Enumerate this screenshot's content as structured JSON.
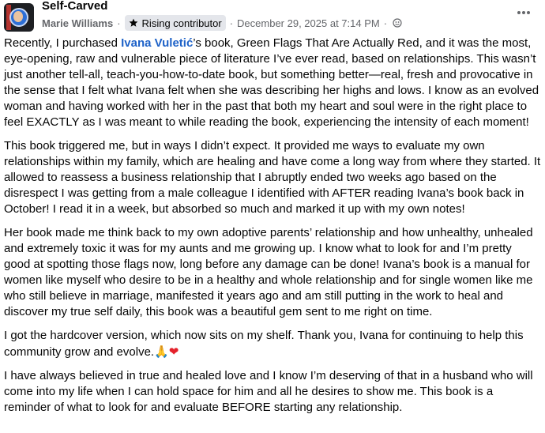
{
  "header": {
    "group_name": "Self-Carved",
    "author": "Marie Williams",
    "badge_label": "Rising contributor",
    "badge_icon": "star-icon",
    "date": "December 29, 2025 at 7:14 PM",
    "audience_icon": "globe-icon",
    "more_icon": "more-horizontal-icon",
    "separator": "·"
  },
  "post": {
    "p1_pre": "Recently, I purchased ",
    "p1_mention": "Ivana Vuletić",
    "p1_post": "’s book, Green Flags That Are Actually Red, and it was the most, eye-opening, raw and vulnerable piece of literature I’ve ever read, based on relationships. This wasn’t just another tell-all, teach-you-how-to-date book, but something better—real, fresh and provocative in the sense that I felt what Ivana felt when she was describing her highs and lows. I know as an evolved woman and having worked with her in the past that both my heart and soul were in the right place to feel EXACTLY as I was meant to while reading the book, experiencing the intensity of each moment!",
    "p2": "This book triggered me, but in ways I didn’t expect. It provided me ways to evaluate my own relationships within my family, which are healing and have come a long way from where they started. It allowed to reassess a business relationship that I abruptly ended two weeks ago based on the disrespect I was getting from a male colleague I identified with AFTER reading Ivana’s book back in October! I read it in a week, but absorbed so much and marked it up with my own notes!",
    "p3": "Her book made me think back to my own adoptive parents’ relationship and how unhealthy, unhealed and extremely toxic it was for my aunts and me growing up. I know what to look for and I’m pretty good at spotting those flags now, long before any damage can be done! Ivana’s book is a manual for women like myself who desire to be in a healthy and whole relationship and for single women like me who still believe in marriage, manifested it years ago and am still putting in the work to heal and discover my true self daily, this book was a beautiful gem sent to me right on time.",
    "p4": "I got the hardcover version, which now sits on my shelf. Thank you, Ivana for continuing to help this community grow and evolve.",
    "p4_emoji_1": "🙏",
    "p4_emoji_2": "❤",
    "p5": "I have always believed in true and healed love and I know I’m deserving of that in a husband who will come into my life when I can hold space for him and all he desires to show me. This book is a reminder of what to look for and evaluate BEFORE starting any relationship."
  },
  "colors": {
    "mention": "#1e62c8",
    "meta_text": "#65676b",
    "badge_bg": "#e4e6eb",
    "heart": "#e4212b"
  }
}
